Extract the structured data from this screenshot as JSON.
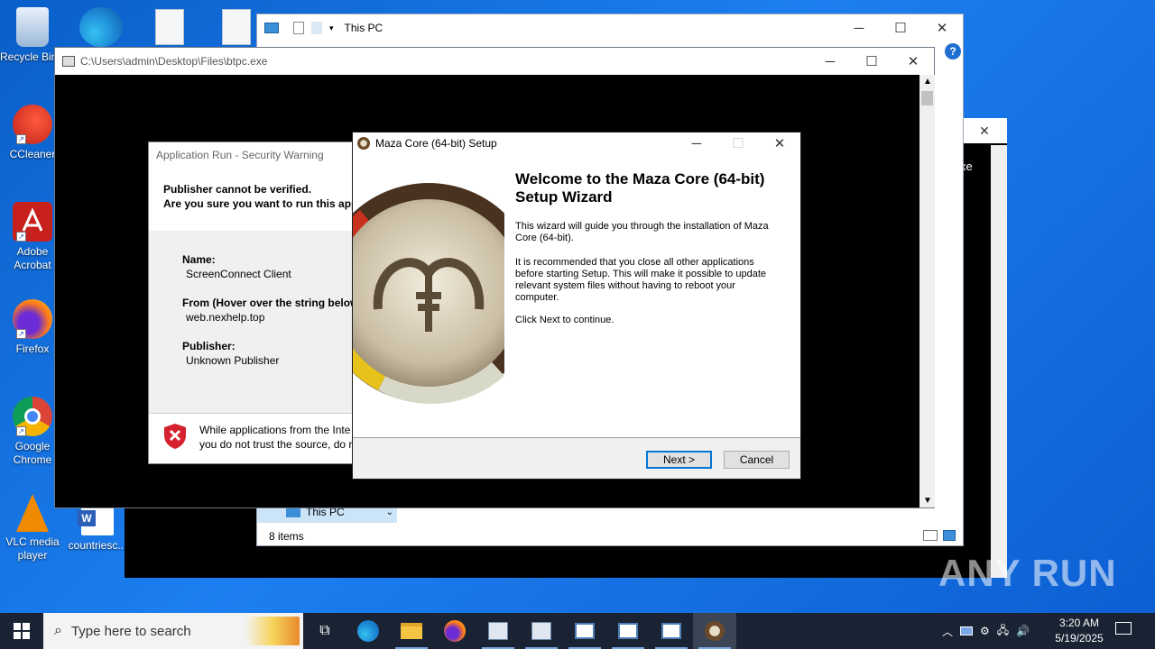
{
  "desktop": {
    "icons": [
      {
        "label": "Recycle Bin",
        "name": "recycle-bin"
      },
      {
        "label": "CCleaner",
        "name": "ccleaner"
      },
      {
        "label": "Adobe Acrobat",
        "name": "adobe-acrobat"
      },
      {
        "label": "Firefox",
        "name": "firefox"
      },
      {
        "label": "Google Chrome",
        "name": "google-chrome"
      },
      {
        "label": "VLC media player",
        "name": "vlc"
      },
      {
        "label": "countriesc...",
        "name": "word-doc"
      }
    ]
  },
  "explorer": {
    "title": "This PC",
    "status": "8 items",
    "nav_item": "This PC"
  },
  "cmd_window": {
    "title": "C:\\Users\\admin\\Desktop\\Files\\btpc.exe"
  },
  "back_window": {
    "fragment": "xe"
  },
  "security_warning": {
    "title": "Application Run - Security Warning",
    "headline1": "Publisher cannot be verified.",
    "headline2": "Are you sure you want to run this appl",
    "name_label": "Name:",
    "name_value": "ScreenConnect Client",
    "from_label": "From (Hover over the string below",
    "from_value": "web.nexhelp.top",
    "publisher_label": "Publisher:",
    "publisher_value": "Unknown Publisher",
    "footer_line1": "While applications from the Inte",
    "footer_line2": "you do not trust the source, do r"
  },
  "setup": {
    "title": "Maza Core (64-bit) Setup",
    "heading": "Welcome to the Maza Core (64-bit) Setup Wizard",
    "para1": "This wizard will guide you through the installation of Maza Core (64-bit).",
    "para2": "It is recommended that you close all other applications before starting Setup. This will make it possible to update relevant system files without having to reboot your computer.",
    "para3": "Click Next to continue.",
    "next_label": "Next >",
    "cancel_label": "Cancel"
  },
  "taskbar": {
    "search_placeholder": "Type here to search",
    "time": "3:20 AM",
    "date": "5/19/2025"
  },
  "watermark": {
    "text": "ANY RUN"
  },
  "colors": {
    "accent": "#0078d7",
    "taskbar": "#1a2333"
  }
}
